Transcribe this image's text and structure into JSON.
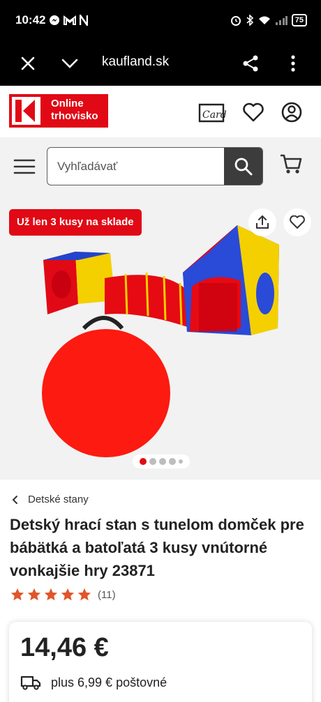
{
  "status_bar": {
    "time": "10:42",
    "left_icons": [
      "messenger-icon",
      "gmail-icon",
      "n-icon"
    ],
    "right_icons": [
      "alarm-icon",
      "bluetooth-icon",
      "wifi-icon",
      "signal-icon"
    ],
    "battery": "75"
  },
  "browser": {
    "url": "kaufland.sk",
    "close_icon": "close-icon",
    "collapse_icon": "chevron-down-icon",
    "share_icon": "share-icon",
    "menu_icon": "more-vertical-icon"
  },
  "header": {
    "logo_text_line1": "Online",
    "logo_text_line2": "trhovisko",
    "card_label": "Card",
    "brand_color": "#e10915"
  },
  "search": {
    "placeholder": "Vyhľadávať"
  },
  "gallery": {
    "stock_badge": "Už len 3 kusy na sklade",
    "slides": 5,
    "active_slide": 1
  },
  "product": {
    "breadcrumb": "Detské stany",
    "title": "Detský hrací stan s tunelom domček pre bábätká a batoľatá 3 kusy vnútorné vonkajšie hry 23871",
    "rating_stars": 5,
    "rating_count": "(11)",
    "price": "14,46 €",
    "shipping": "plus 6,99 € poštovné"
  }
}
